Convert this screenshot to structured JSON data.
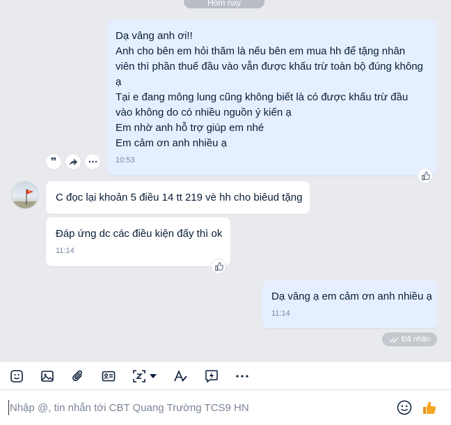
{
  "date_divider": "Hôm nay",
  "messages": [
    {
      "direction": "sent",
      "lines": [
        "Dạ vâng anh ơi!!",
        "Anh cho bên em hỏi thăm là nếu bên em mua hh để tặng nhân",
        "viên thì phần thuế đầu vào vẫn được khấu trừ toàn bộ đúng không",
        "ạ",
        "Tại e đang mông lung cũng không biết là có được khấu trừ đầu",
        "vào không do có nhiều nguồn ý kiến ạ",
        "Em nhờ anh hỗ trợ giúp em nhé",
        "Em cảm ơn anh nhiều ạ"
      ],
      "time": "10:53"
    },
    {
      "direction": "received",
      "lines": [
        "C đọc lại khoản 5 điều 14 tt 219 vè hh cho biêud tặng"
      ]
    },
    {
      "direction": "received",
      "lines": [
        "Đáp ứng dc các điều kiện đấy thì ok"
      ],
      "time": "11:14"
    },
    {
      "direction": "sent",
      "lines": [
        "Dạ vâng ạ em cảm ơn anh nhiều ạ"
      ],
      "time": "11:14"
    }
  ],
  "status_label": "Đã nhận",
  "composer": {
    "placeholder": "Nhập @, tin nhắn tới CBT Quang Trường TCS9 HN"
  },
  "icons": {
    "message_actions": [
      "quote-icon",
      "forward-icon",
      "more-icon"
    ],
    "reaction": "like-icon",
    "toolbar": [
      "sticker-icon",
      "image-icon",
      "attachment-icon",
      "contact-card-icon",
      "screenshot-icon",
      "dropdown-caret-icon",
      "text-format-icon",
      "quick-message-icon",
      "more-icon"
    ],
    "composer": [
      "emoji-icon",
      "thumbs-up-icon"
    ]
  },
  "colors": {
    "sent_bubble": "#e5efff",
    "received_bubble": "#ffffff",
    "chat_background": "#e9eaee",
    "time_text": "#7589a3",
    "thumbs_up": "#f5a623"
  }
}
